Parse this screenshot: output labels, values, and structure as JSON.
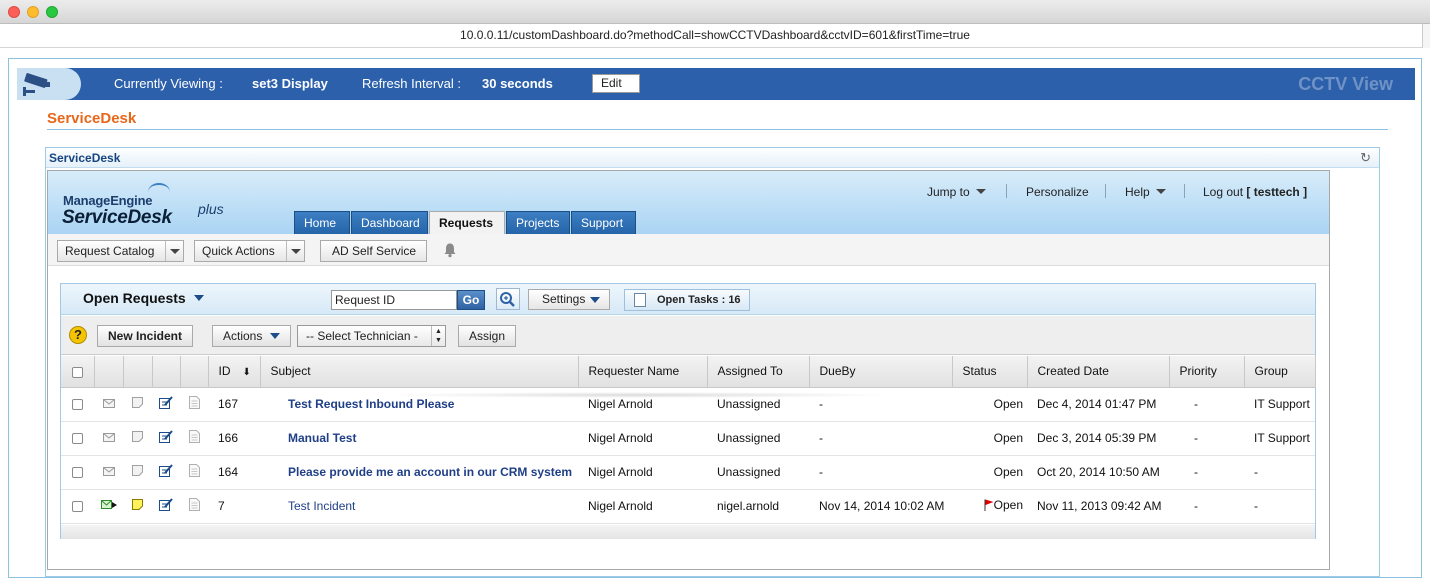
{
  "browser": {
    "url": "10.0.0.11/customDashboard.do?methodCall=showCCTVDashboard&cctvID=601&firstTime=true"
  },
  "cctv": {
    "viewing_label": "Currently Viewing :",
    "viewing_value": "set3 Display",
    "refresh_label": "Refresh Interval :",
    "refresh_value": "30 seconds",
    "edit_label": "Edit",
    "brand": "CCTV View"
  },
  "section_title": "ServiceDesk",
  "widget_title": "ServiceDesk",
  "app": {
    "logo_top": "ManageEngine",
    "logo_main": "ServiceDesk",
    "logo_plus": "plus",
    "topnav": {
      "jump_to": "Jump to",
      "personalize": "Personalize",
      "help": "Help",
      "logout": "Log out",
      "user": "[ testtech ]"
    },
    "tabs": [
      "Home",
      "Dashboard",
      "Requests",
      "Projects",
      "Support"
    ],
    "active_tab": "Requests",
    "toolbar": {
      "request_catalog": "Request Catalog",
      "quick_actions": "Quick Actions",
      "ad_self_service": "AD Self Service"
    }
  },
  "panel": {
    "view_title": "Open Requests",
    "search_value": "Request ID",
    "go_label": "Go",
    "settings_label": "Settings",
    "tasks_label": "Open Tasks : 16",
    "new_incident": "New Incident",
    "actions": "Actions",
    "select_technician": "-- Select Technician -",
    "assign": "Assign"
  },
  "table": {
    "columns": [
      "ID",
      "Subject",
      "Requester Name",
      "Assigned To",
      "DueBy",
      "Status",
      "Created Date",
      "Priority",
      "Group"
    ],
    "rows": [
      {
        "id": "167",
        "subject": "Test Request Inbound Please",
        "requester": "Nigel Arnold",
        "assigned": "Unassigned",
        "dueby": "-",
        "status": "Open",
        "created": "Dec 4, 2014 01:47 PM",
        "priority": "-",
        "group": "IT Support"
      },
      {
        "id": "166",
        "subject": "Manual Test",
        "requester": "Nigel Arnold",
        "assigned": "Unassigned",
        "dueby": "-",
        "status": "Open",
        "created": "Dec 3, 2014 05:39 PM",
        "priority": "-",
        "group": "IT Support"
      },
      {
        "id": "164",
        "subject": "Please provide me an account in our CRM system",
        "requester": "Nigel Arnold",
        "assigned": "Unassigned",
        "dueby": "-",
        "status": "Open",
        "created": "Oct 20, 2014 10:50 AM",
        "priority": "-",
        "group": "-"
      },
      {
        "id": "7",
        "subject": "Test Incident",
        "requester": "Nigel Arnold",
        "assigned": "nigel.arnold",
        "dueby": "Nov 14, 2014 10:02 AM",
        "status": "Open",
        "created": "Nov 11, 2013 09:42 AM",
        "priority": "-",
        "group": "-"
      }
    ]
  },
  "colors": {
    "cctv_bar": "#2c60ab",
    "section_title": "#e8671b",
    "link": "#1f3f87",
    "tab": "#2f6db3"
  }
}
